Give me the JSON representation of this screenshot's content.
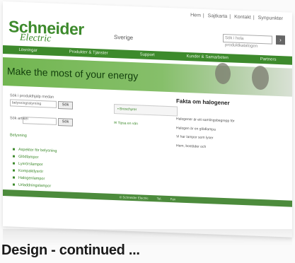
{
  "header": {
    "logo_line1": "Schneider",
    "logo_line2": "Electric",
    "country": "Sverige",
    "top_links": [
      "Hem",
      "Sajtkarta",
      "Kontakt",
      "Synpunkter"
    ],
    "search_placeholder": "Sök i hela produktkatalogen",
    "search_icon": "arrow-right-icon"
  },
  "nav": {
    "items": [
      "Lösningar",
      "Produkter & Tjänster",
      "Support",
      "Kunder & Samarbeten",
      "Partners"
    ]
  },
  "banner": {
    "text": "Make the most of your energy"
  },
  "left": {
    "search1_label": "Sök i produkthjälp medan",
    "search1_value": "belysningsstyrning",
    "search2_label": "Sök artikel",
    "btn_label": "Sök",
    "topics_label": "Belysning",
    "topics": [
      "Aspekter för belysning",
      "Glödlampor",
      "Lysrörslampor",
      "Kompaktlysrör",
      "Halogenlampor",
      "Urladdningslampor"
    ]
  },
  "middle": {
    "download_label": "Broschyrer",
    "tip_label": "Tipsa en vän"
  },
  "right": {
    "title": "Fakta om halogener",
    "paragraphs": [
      "Halogener är ett samlingsbegrepp för",
      "Halogen är en glödlampa",
      "Vi har lampor som lyser",
      "Hem, bostäder och"
    ]
  },
  "footer": {
    "items": [
      "© Schneider Electric",
      "Tel.",
      "Fax"
    ]
  },
  "caption": "Design - continued ..."
}
